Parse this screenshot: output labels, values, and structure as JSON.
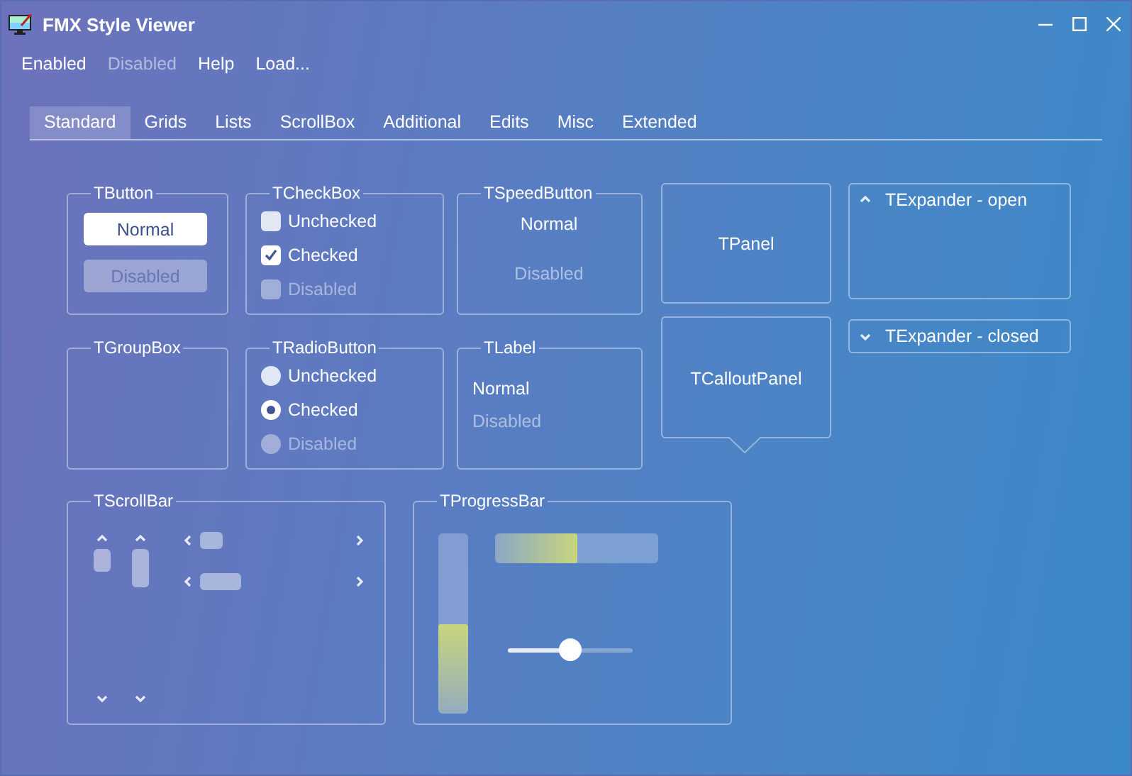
{
  "window": {
    "title": "FMX Style Viewer"
  },
  "menu": [
    {
      "label": "Enabled",
      "disabled": false
    },
    {
      "label": "Disabled",
      "disabled": true
    },
    {
      "label": "Help",
      "disabled": false
    },
    {
      "label": "Load...",
      "disabled": false
    }
  ],
  "tabs": [
    {
      "label": "Standard",
      "selected": true
    },
    {
      "label": "Grids",
      "selected": false
    },
    {
      "label": "Lists",
      "selected": false
    },
    {
      "label": "ScrollBox",
      "selected": false
    },
    {
      "label": "Additional",
      "selected": false
    },
    {
      "label": "Edits",
      "selected": false
    },
    {
      "label": "Misc",
      "selected": false
    },
    {
      "label": "Extended",
      "selected": false
    }
  ],
  "button_group": {
    "title": "TButton",
    "buttons": [
      {
        "label": "Normal",
        "disabled": false
      },
      {
        "label": "Disabled",
        "disabled": true
      }
    ]
  },
  "checkbox_group": {
    "title": "TCheckBox",
    "items": [
      {
        "label": "Unchecked",
        "checked": false,
        "disabled": false
      },
      {
        "label": "Checked",
        "checked": true,
        "disabled": false
      },
      {
        "label": "Disabled",
        "checked": false,
        "disabled": true
      }
    ]
  },
  "speedbutton_group": {
    "title": "TSpeedButton",
    "buttons": [
      {
        "label": "Normal",
        "disabled": false
      },
      {
        "label": "Disabled",
        "disabled": true
      }
    ]
  },
  "group_box": {
    "title": "TGroupBox"
  },
  "radio_group": {
    "title": "TRadioButton",
    "items": [
      {
        "label": "Unchecked",
        "selected": false,
        "disabled": false
      },
      {
        "label": "Checked",
        "selected": true,
        "disabled": false
      },
      {
        "label": "Disabled",
        "selected": false,
        "disabled": true
      }
    ]
  },
  "label_group": {
    "title": "TLabel",
    "labels": [
      {
        "text": "Normal",
        "disabled": false
      },
      {
        "text": "Disabled",
        "disabled": true
      }
    ]
  },
  "panel": {
    "text": "TPanel"
  },
  "callout_panel": {
    "text": "TCalloutPanel"
  },
  "expanders": [
    {
      "title": "TExpander - open",
      "expanded": true
    },
    {
      "title": "TExpander - closed",
      "expanded": false
    }
  ],
  "scrollbar_group": {
    "title": "TScrollBar"
  },
  "progress_group": {
    "title": "TProgressBar",
    "horizontal": {
      "level": 0.5
    },
    "vertical": {
      "level": 0.5
    },
    "slider": {
      "level": 0.5
    }
  }
}
